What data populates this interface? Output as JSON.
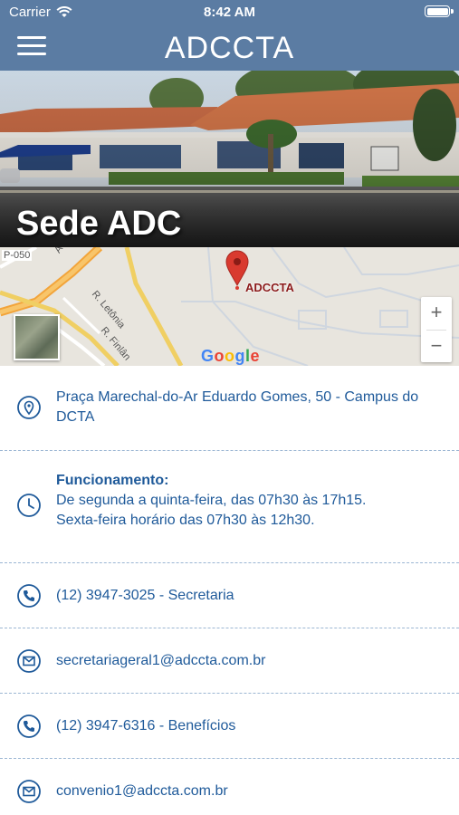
{
  "status": {
    "carrier": "Carrier",
    "time": "8:42 AM"
  },
  "nav": {
    "title": "ADCCTA",
    "menu_icon": "hamburger-menu-icon"
  },
  "hero": {
    "title": "Sede ADC"
  },
  "map": {
    "marker_label": "ADCCTA",
    "road_labels": [
      "P-050",
      "Av",
      "R. Letônia",
      "R. Finlân"
    ],
    "zoom_in": "+",
    "zoom_out": "−",
    "google_letters": [
      "G",
      "o",
      "o",
      "g",
      "l",
      "e"
    ]
  },
  "info": {
    "address": "Praça Marechal-do-Ar Eduardo Gomes, 50 - Campus do DCTA",
    "hours_title": "Funcionamento:",
    "hours_line1": "De segunda a quinta-feira, das 07h30 às 17h15.",
    "hours_line2": "Sexta-feira horário das 07h30 às 12h30.",
    "phone1": "(12) 3947-3025 - Secretaria",
    "email1": "secretariageral1@adccta.com.br",
    "phone2": "(12) 3947-6316 - Benefícios",
    "email2": "convenio1@adccta.com.br"
  },
  "colors": {
    "header": "#5b7ca3",
    "link": "#1f5a9a",
    "divider": "#9bb6d3",
    "marker": "#d93a2f"
  }
}
